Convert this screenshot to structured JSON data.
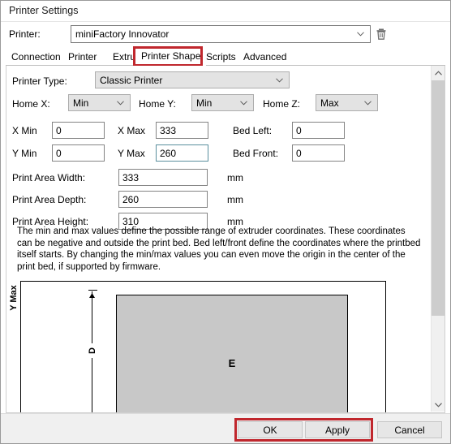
{
  "window": {
    "title": "Printer Settings"
  },
  "printer_select": {
    "label": "Printer:",
    "value": "miniFactory Innovator",
    "delete_icon": "trash-icon",
    "dropdown_icon": "chevron-down-icon"
  },
  "tabs": [
    {
      "label": "Connection",
      "active": false
    },
    {
      "label": "Printer",
      "active": false
    },
    {
      "label": "Extruder",
      "active": false
    },
    {
      "label": "Printer Shape",
      "active": true
    },
    {
      "label": "Scripts",
      "active": false
    },
    {
      "label": "Advanced",
      "active": false
    }
  ],
  "form": {
    "printer_type": {
      "label": "Printer Type:",
      "value": "Classic Printer"
    },
    "home_x": {
      "label": "Home X:",
      "value": "Min"
    },
    "home_y": {
      "label": "Home Y:",
      "value": "Min"
    },
    "home_z": {
      "label": "Home Z:",
      "value": "Max"
    },
    "x_min": {
      "label": "X Min",
      "value": "0"
    },
    "x_max": {
      "label": "X Max",
      "value": "333"
    },
    "bed_left": {
      "label": "Bed Left:",
      "value": "0"
    },
    "y_min": {
      "label": "Y Min",
      "value": "0"
    },
    "y_max": {
      "label": "Y Max",
      "value": "260"
    },
    "bed_front": {
      "label": "Bed Front:",
      "value": "0"
    },
    "print_area_width": {
      "label": "Print Area Width:",
      "value": "333",
      "unit": "mm"
    },
    "print_area_depth": {
      "label": "Print Area Depth:",
      "value": "260",
      "unit": "mm"
    },
    "print_area_height": {
      "label": "Print Area Height:",
      "value": "310",
      "unit": "mm"
    }
  },
  "help": {
    "text": "The min and max values define the possible range of extruder coordinates. These coordinates can be negative and outside the print bed. Bed left/front define the coordinates where the printbed itself starts. By changing the min/max values you can even move the origin in the center of the print bed, if supported by firmware."
  },
  "preview": {
    "y_max_label": "Y Max",
    "depth_label": "D",
    "bed_label": "E"
  },
  "footer": {
    "ok": "OK",
    "apply": "Apply",
    "cancel": "Cancel"
  },
  "colors": {
    "annotation": "#c0272d",
    "focus_border": "#5a8f9e",
    "bed_fill": "#c8c8c8"
  }
}
